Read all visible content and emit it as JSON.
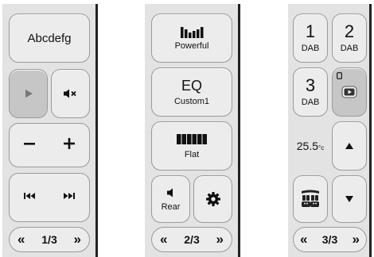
{
  "panel1": {
    "source_button_label": "Abcdefg",
    "play_icon": "play-icon",
    "mute_icon": "mute-icon",
    "volume_down_icon": "minus-icon",
    "volume_up_icon": "plus-icon",
    "prev_icon": "skip-previous-icon",
    "next_icon": "skip-next-icon",
    "pager": {
      "prev": "«",
      "page": "1/3",
      "next": "»"
    }
  },
  "panel2": {
    "powerful_label": "Powerful",
    "eq_title": "EQ",
    "eq_preset": "Custom1",
    "flat_label": "Flat",
    "rear_label": "Rear",
    "settings_icon": "gear-icon",
    "pager": {
      "prev": "«",
      "page": "2/3",
      "next": "»"
    }
  },
  "panel3": {
    "preset1": {
      "number": "1",
      "band": "DAB"
    },
    "preset2": {
      "number": "2",
      "band": "DAB"
    },
    "preset3": {
      "number": "3",
      "band": "DAB"
    },
    "video_icon": "youtube-icon",
    "temperature": "25.5",
    "temperature_unit": "°c",
    "up_icon": "arrow-up-icon",
    "down_icon": "arrow-down-icon",
    "seat_heat_icon": "seat-heater-icon",
    "pager": {
      "prev": "«",
      "page": "3/3",
      "next": "»"
    }
  }
}
